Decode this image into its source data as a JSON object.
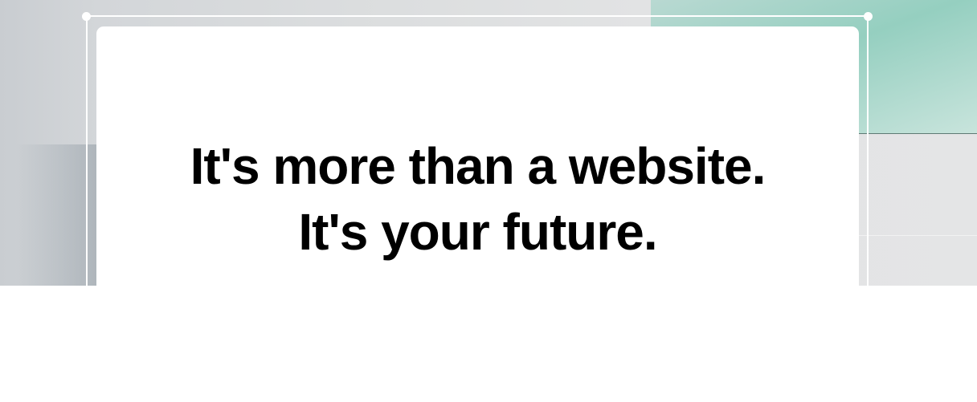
{
  "hero": {
    "headline_line1": "It's more than a website.",
    "headline_line2": "It's your future."
  },
  "colors": {
    "accent_teal": "#95cfc0",
    "text": "#000000"
  }
}
